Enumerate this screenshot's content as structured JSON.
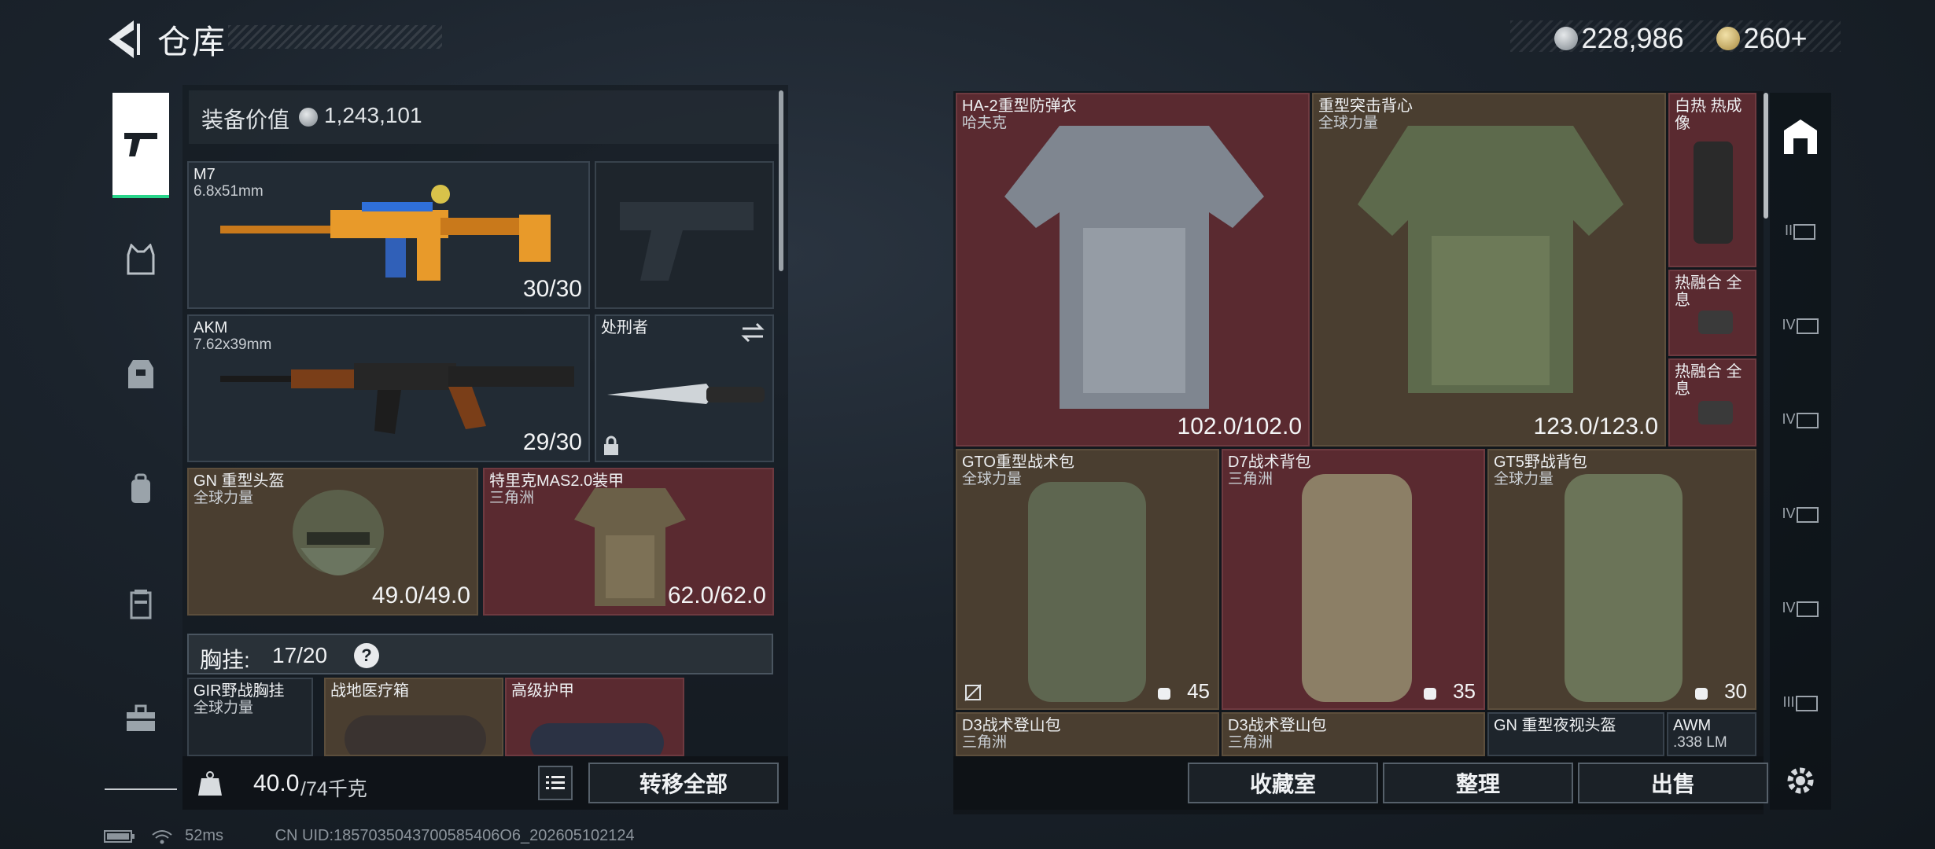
{
  "header": {
    "title": "仓库",
    "currency_1": "228,986",
    "currency_2": "260",
    "currency_2_add": "+"
  },
  "left_panel": {
    "equip_value_label": "装备价值",
    "equip_value": "1,243,101",
    "slots": [
      {
        "name": "M7",
        "sub": "6.8x51mm",
        "value": "30/30"
      },
      {
        "name": "AKM",
        "sub": "7.62x39mm",
        "value": "29/30"
      },
      {
        "name": "处刑者",
        "sub": "",
        "value": ""
      },
      {
        "name": "GN 重型头盔",
        "sub": "全球力量",
        "value": "49.0/49.0"
      },
      {
        "name": "特里克MAS2.0装甲",
        "sub": "三角洲",
        "value": "62.0/62.0"
      },
      {
        "name": "GIR野战胸挂",
        "sub": "全球力量",
        "value": ""
      },
      {
        "name": "战地医疗箱",
        "sub": "",
        "value": ""
      },
      {
        "name": "高级护甲",
        "sub": "",
        "value": ""
      }
    ],
    "chest_label": "胸挂:",
    "chest_count": "17/20",
    "chest_help": "?",
    "weight_current": "40.0",
    "weight_max": "/74千克",
    "transfer_all": "转移全部"
  },
  "right_panel": {
    "items": [
      {
        "name": "HA-2重型防弹衣",
        "sub": "哈夫克",
        "value": "102.0/102.0"
      },
      {
        "name": "重型突击背心",
        "sub": "全球力量",
        "value": "123.0/123.0"
      },
      {
        "name": "白热 热成像",
        "sub": "",
        "value": ""
      },
      {
        "name": "热融合 全息",
        "sub": "",
        "value": ""
      },
      {
        "name": "热融合 全息",
        "sub": "",
        "value": ""
      },
      {
        "name": "GTO重型战术包",
        "sub": "全球力量",
        "value": "45"
      },
      {
        "name": "D7战术背包",
        "sub": "三角洲",
        "value": "35"
      },
      {
        "name": "GT5野战背包",
        "sub": "全球力量",
        "value": "30"
      },
      {
        "name": "D3战术登山包",
        "sub": "三角洲",
        "value": ""
      },
      {
        "name": "D3战术登山包",
        "sub": "三角洲",
        "value": ""
      },
      {
        "name": "GN 重型夜视头盔",
        "sub": "",
        "value": ""
      },
      {
        "name": "AWM",
        "sub": ".338 LM",
        "value": ""
      }
    ],
    "sidebar_levels": [
      "II",
      "IV",
      "IV",
      "IV",
      "IV",
      "III"
    ],
    "buttons": {
      "collection": "收藏室",
      "organize": "整理",
      "sell": "出售"
    }
  },
  "status": {
    "ping": "52ms",
    "uid": "CN UID:1857035043700585406O6_202605102124"
  }
}
